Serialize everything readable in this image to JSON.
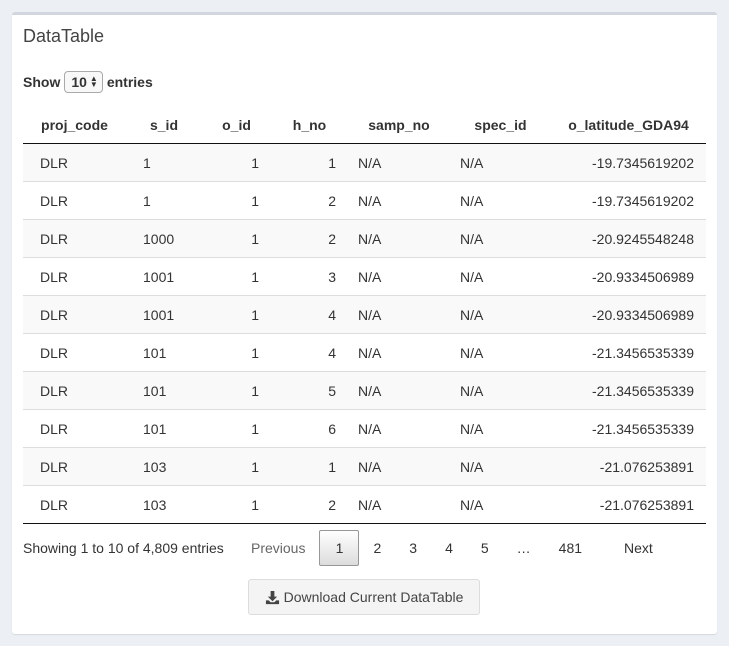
{
  "box": {
    "title": "DataTable"
  },
  "length_menu": {
    "prefix": "Show",
    "value": "10",
    "suffix": "entries"
  },
  "columns": [
    "proj_code",
    "s_id",
    "o_id",
    "h_no",
    "samp_no",
    "spec_id",
    "o_latitude_GDA94"
  ],
  "rows": [
    [
      "DLR",
      "1",
      "1",
      "1",
      "N/A",
      "N/A",
      "-19.7345619202"
    ],
    [
      "DLR",
      "1",
      "1",
      "2",
      "N/A",
      "N/A",
      "-19.7345619202"
    ],
    [
      "DLR",
      "1000",
      "1",
      "2",
      "N/A",
      "N/A",
      "-20.9245548248"
    ],
    [
      "DLR",
      "1001",
      "1",
      "3",
      "N/A",
      "N/A",
      "-20.9334506989"
    ],
    [
      "DLR",
      "1001",
      "1",
      "4",
      "N/A",
      "N/A",
      "-20.9334506989"
    ],
    [
      "DLR",
      "101",
      "1",
      "4",
      "N/A",
      "N/A",
      "-21.3456535339"
    ],
    [
      "DLR",
      "101",
      "1",
      "5",
      "N/A",
      "N/A",
      "-21.3456535339"
    ],
    [
      "DLR",
      "101",
      "1",
      "6",
      "N/A",
      "N/A",
      "-21.3456535339"
    ],
    [
      "DLR",
      "103",
      "1",
      "1",
      "N/A",
      "N/A",
      "-21.076253891"
    ],
    [
      "DLR",
      "103",
      "1",
      "2",
      "N/A",
      "N/A",
      "-21.076253891"
    ]
  ],
  "info": "Showing 1 to 10 of 4,809 entries",
  "pagination": {
    "previous": "Previous",
    "pages": [
      "1",
      "2",
      "3",
      "4",
      "5"
    ],
    "current": "1",
    "ellipsis": "…",
    "last": "481",
    "next": "Next"
  },
  "download_button": {
    "label": "Download Current DataTable",
    "icon": "download-icon"
  }
}
